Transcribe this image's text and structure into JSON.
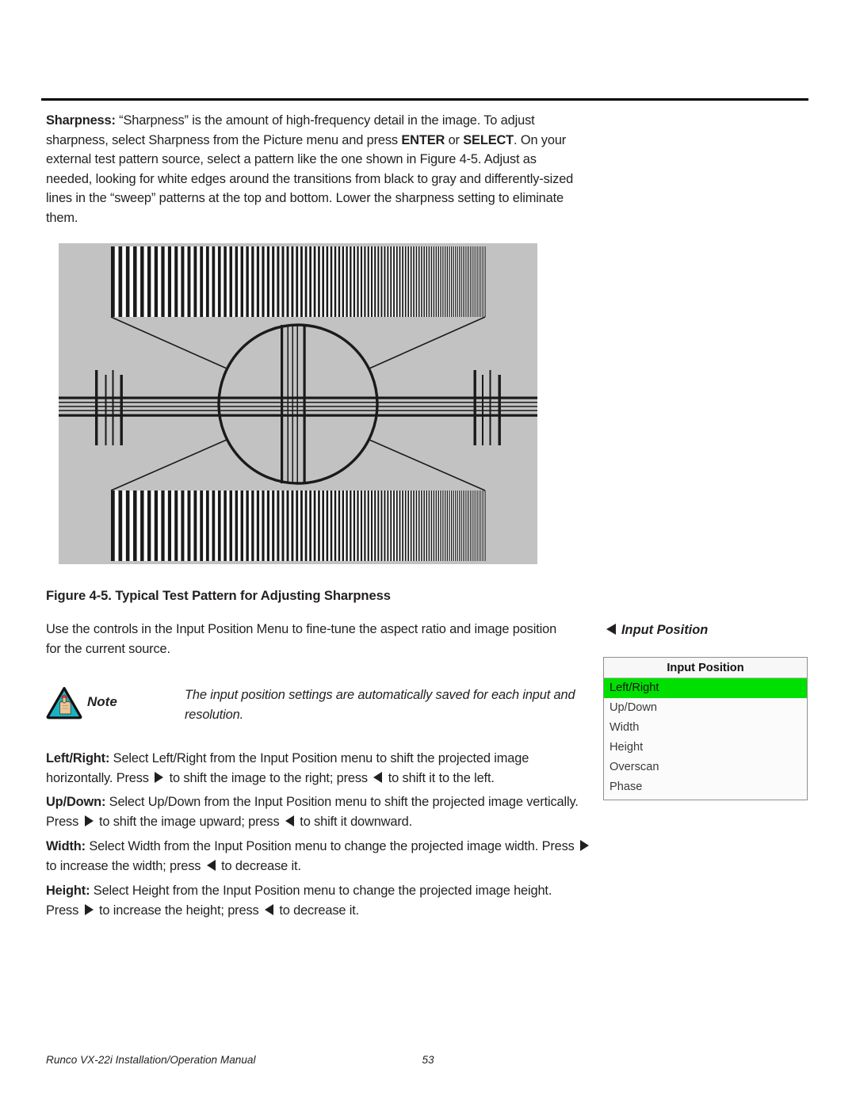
{
  "document": {
    "title": "Runco VX-22i Installation/Operation Manual",
    "page_number": "53"
  },
  "body": {
    "sharpness_label": "Sharpness:",
    "sharpness_p1": " “Sharpness” is the amount of high-frequency detail in the image. To adjust sharpness, select Sharpness from the Picture menu and press ",
    "enter_label": "ENTER",
    "or_label": " or ",
    "select_label": "SELECT",
    "sharpness_p2": ". On your external test pattern source, select a pattern like the one shown in Figure 4-5. Adjust as needed, looking for white edges around the transitions from black to gray and differently-sized lines in the “sweep” patterns at the top and bottom. Lower the sharpness setting to eliminate them.",
    "use_controls": "Use the controls in the Input Position Menu to fine-tune the aspect ratio and image position for the current source.",
    "left_right_label": "Left/Right:",
    "left_right_a": " Select Left/Right from the Input Position menu to shift the projected image horizontally. Press ",
    "left_right_b": " to shift the image to the right; press ",
    "left_right_c": " to shift it to the left.",
    "up_down_label": "Up/Down:",
    "up_down_a": " Select Up/Down from the Input Position menu to shift the projected image vertically. Press ",
    "up_down_b": " to shift the image upward; press ",
    "up_down_c": " to shift it downward.",
    "width_label": "Width:",
    "width_a": " Select Width from the Input Position menu to change the projected image width. Press ",
    "width_b": " to increase the width; press ",
    "width_c": " to decrease it.",
    "height_label": "Height:",
    "height_a": " Select Height from the Input Position menu to change the projected image height. Press ",
    "height_b": " to increase the height; press ",
    "height_c": " to decrease it."
  },
  "figure": {
    "caption": "Figure 4-5. Typical Test Pattern for Adjusting Sharpness",
    "background_color": "#c2c2c2",
    "line_color": "#1a1a1a",
    "description": "Test pattern with frequency sweep gratings top and bottom, center circle, crosshair and resolution wedge bars"
  },
  "note": {
    "label": "Note",
    "text": "The input position settings are automatically saved for each input and resolution.",
    "icon_fill": "#19b2c4",
    "icon_border": "#111111",
    "hand_color": "#e8c79a",
    "string_color": "#d8232a"
  },
  "input_position": {
    "heading": "Input Position",
    "menu_title": "Input Position",
    "highlight_color": "#00e000",
    "items": [
      {
        "label": "Left/Right",
        "selected": true
      },
      {
        "label": "Up/Down",
        "selected": false
      },
      {
        "label": "Width",
        "selected": false
      },
      {
        "label": "Height",
        "selected": false
      },
      {
        "label": "Overscan",
        "selected": false
      },
      {
        "label": "Phase",
        "selected": false
      }
    ]
  }
}
